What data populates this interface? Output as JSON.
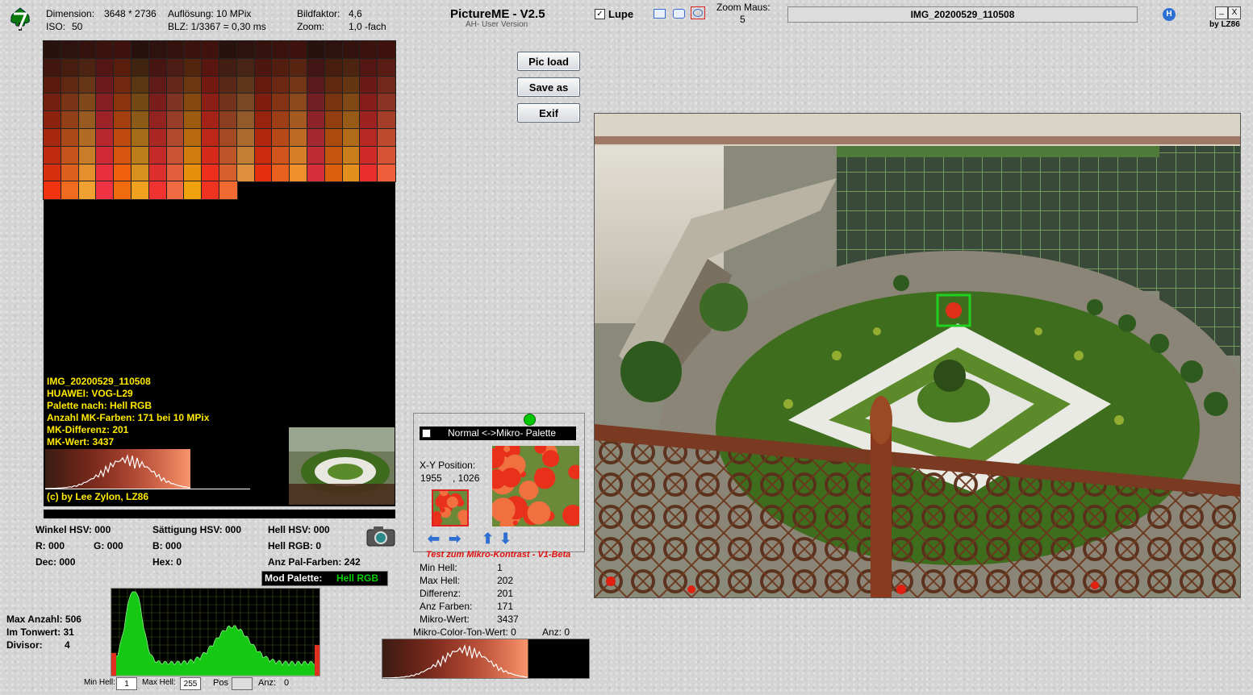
{
  "header": {
    "dimension_label": "Dimension:",
    "dimension_value": "3648 * 2736",
    "iso_label": "ISO:",
    "iso_value": "50",
    "resolution": "Auflösung: 10 MPix",
    "blz": "BLZ: 1/3367 = 0,30 ms",
    "bildfaktor_label": "Bildfaktor:",
    "bildfaktor_value": "4,6",
    "zoom_label": "Zoom:",
    "zoom_value": "1,0 -fach",
    "app_title": "PictureME - V2.5",
    "app_subtitle": "AH- User Version",
    "lupe_label": "Lupe",
    "zoom_maus_label": "Zoom Maus:",
    "zoom_maus_value": "5",
    "filename": "IMG_20200529_110508",
    "help_glyph": "H",
    "byline": "by LZ86",
    "min_glyph": "_",
    "close_glyph": "X"
  },
  "buttons": {
    "pic_load": "Pic load",
    "save_as": "Save as",
    "exif": "Exif"
  },
  "info_overlay": {
    "line1": "IMG_20200529_110508",
    "line2": "HUAWEI: VOG-L29",
    "line3": "Palette nach: Hell RGB",
    "line4": "Anzahl MK-Farben: 171  bei 10 MPix",
    "line5": "MK-Differenz: 201",
    "line6": "MK-Wert: 3437",
    "copyright": "(c) by Lee Zylon, LZ86"
  },
  "color_values": {
    "winkel_hsv": "Winkel HSV:  000",
    "saettigung_hsv": "Sättigung HSV:  000",
    "hell_hsv": "Hell HSV:    000",
    "r": "R:   000",
    "g": "G:   000",
    "b": "B:   000",
    "hell_rgb": "Hell RGB: 0",
    "dec": "Dec: 000",
    "hex": "Hex: 0",
    "anz_pal_farben": "Anz Pal-Farben:    242",
    "mod_palette_label": "Mod Palette:",
    "mod_palette_value": "Hell RGB"
  },
  "histogram_stats": {
    "max_anzahl": "Max Anzahl: 506",
    "im_tonwert": "Im Tonwert:  31",
    "divisor_label": "Divisor:",
    "divisor_value": "4",
    "min_hell_label": "Min Hell:",
    "min_hell_value": "1",
    "max_hell_label": "Max Hell:",
    "max_hell_value": "255",
    "pos_label": "Pos",
    "anz_label": "Anz:",
    "anz_value": "0"
  },
  "micro_panel": {
    "toggle_label": "Normal <->Mikro- Palette",
    "xy_label": "X-Y Position:",
    "x_value": "1955",
    "y_value": ", 1026",
    "test_label": "Test zum Mikro-Kontrast - V1-Beta",
    "rows": [
      {
        "label": "Min Hell:",
        "value": "1"
      },
      {
        "label": "Max Hell:",
        "value": "202"
      },
      {
        "label": "Differenz:",
        "value": "201"
      },
      {
        "label": "Anz Farben:",
        "value": "171"
      },
      {
        "label": "Mikro-Wert:",
        "value": "3437"
      }
    ],
    "color_ton_label": "Mikro-Color-Ton-Wert: 0",
    "color_ton_anz": "Anz:  0"
  },
  "colors": {
    "accent_green": "#00c800",
    "overlay_yellow": "#ffea00",
    "test_red": "#e01010"
  }
}
